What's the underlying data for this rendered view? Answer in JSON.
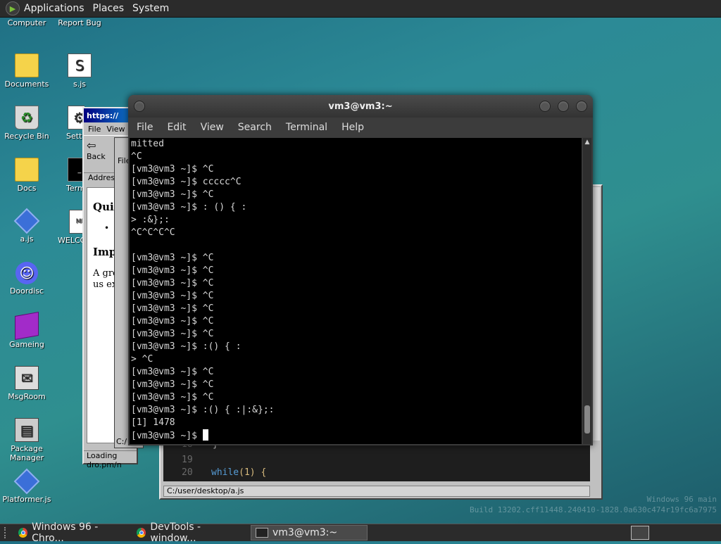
{
  "top_panel": {
    "applications": "Applications",
    "places": "Places",
    "system": "System"
  },
  "desktop_icons": [
    {
      "label": "Computer"
    },
    {
      "label": "Report Bug"
    },
    {
      "label": "Documents"
    },
    {
      "label": "s.js"
    },
    {
      "label": "Recycle Bin"
    },
    {
      "label": "Setti"
    },
    {
      "label": "Docs"
    },
    {
      "label": "Term"
    },
    {
      "label": "a.js"
    },
    {
      "label": "WELCO"
    },
    {
      "label": "Doordisc"
    },
    {
      "label": "Gameing"
    },
    {
      "label": "MsgRoom"
    },
    {
      "label": "Package Manager"
    },
    {
      "label": "Platformer.js"
    }
  ],
  "browser_window": {
    "title": "https://",
    "menu": [
      "File",
      "View"
    ],
    "back_label": "Back",
    "address_label": "Addres",
    "headings": [
      "Qui",
      "Imp"
    ],
    "paragraph": "A gre be us expe",
    "status": "Loading dro.pm/n"
  },
  "file_window": {
    "menu": "File",
    "path": "C:/"
  },
  "editor_window": {
    "lines": [
      {
        "num": "18",
        "text": "}"
      },
      {
        "num": "19",
        "text": ""
      },
      {
        "num": "20",
        "kw": "while",
        "rest": "(1) {"
      }
    ],
    "path": "C:/user/desktop/a.js"
  },
  "watermark": {
    "line1": "Windows 96 main",
    "line2": "Build 13202.cff11448.240410-1828.0a630c474r19fc6a7975"
  },
  "terminal": {
    "title": "vm3@vm3:~",
    "menu": [
      "File",
      "Edit",
      "View",
      "Search",
      "Terminal",
      "Help"
    ],
    "lines": [
      "mitted",
      "^C",
      "[vm3@vm3 ~]$ ^C",
      "[vm3@vm3 ~]$ ccccc^C",
      "[vm3@vm3 ~]$ ^C",
      "[vm3@vm3 ~]$ : () { :",
      "> :&};:",
      "^C^C^C^C",
      "",
      "[vm3@vm3 ~]$ ^C",
      "[vm3@vm3 ~]$ ^C",
      "[vm3@vm3 ~]$ ^C",
      "[vm3@vm3 ~]$ ^C",
      "[vm3@vm3 ~]$ ^C",
      "[vm3@vm3 ~]$ ^C",
      "[vm3@vm3 ~]$ ^C",
      "[vm3@vm3 ~]$ :() { :",
      "> ^C",
      "[vm3@vm3 ~]$ ^C",
      "[vm3@vm3 ~]$ ^C",
      "[vm3@vm3 ~]$ ^C",
      "[vm3@vm3 ~]$ :() { :|:&};:",
      "[1] 1478"
    ],
    "prompt": "[vm3@vm3 ~]$ "
  },
  "taskbar": {
    "tasks": [
      {
        "label": "Windows 96 - Chro..."
      },
      {
        "label": "DevTools - window..."
      },
      {
        "label": "vm3@vm3:~"
      }
    ]
  }
}
